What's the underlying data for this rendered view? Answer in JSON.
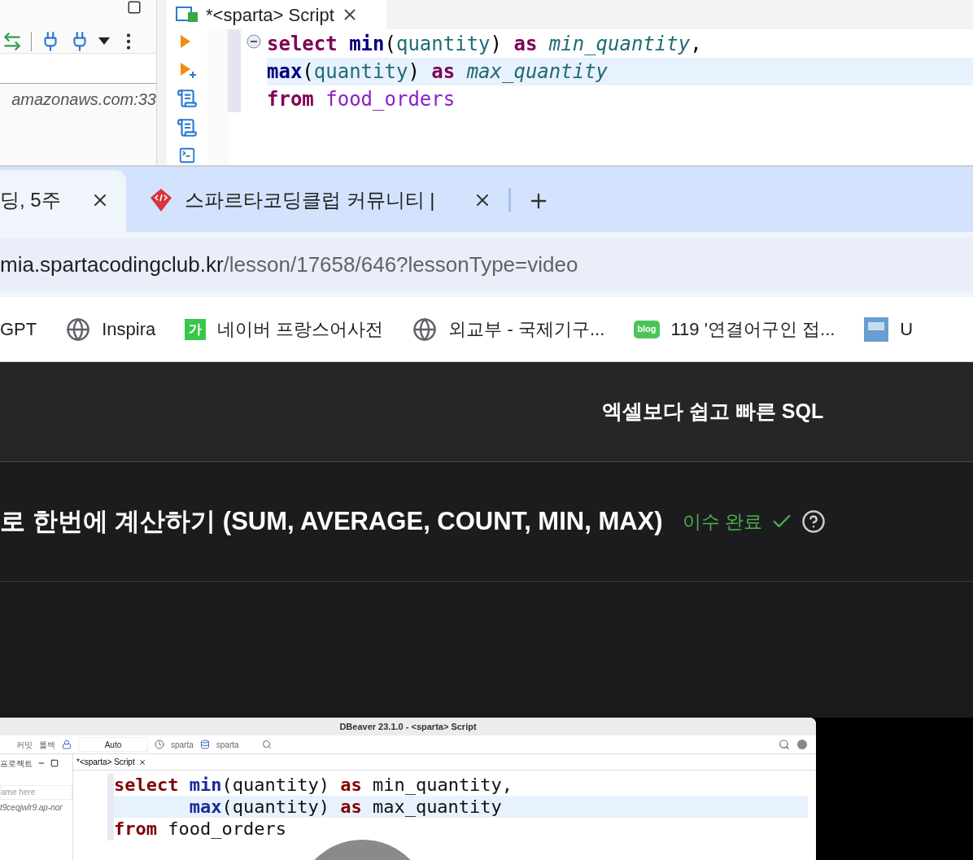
{
  "dbeaver": {
    "connection_text": "amazonaws.com:33",
    "editor_tab": {
      "title": "*<sparta> Script",
      "selected": true
    },
    "code_lines": [
      {
        "highlighted": false,
        "tokens": [
          {
            "kind": "keyword",
            "text": "select"
          },
          {
            "kind": "function",
            "text": " min"
          },
          {
            "kind": "punct",
            "text": "("
          },
          {
            "kind": "column",
            "text": "quantity"
          },
          {
            "kind": "punct",
            "text": ")"
          },
          {
            "kind": "keyword",
            "text": " as"
          },
          {
            "kind": "alias",
            "text": " min_quantity"
          },
          {
            "kind": "punct",
            "text": ","
          }
        ]
      },
      {
        "highlighted": true,
        "tokens": [
          {
            "kind": "function",
            "text": "max"
          },
          {
            "kind": "punct",
            "text": "("
          },
          {
            "kind": "column",
            "text": "quantity"
          },
          {
            "kind": "punct",
            "text": ")"
          },
          {
            "kind": "keyword",
            "text": " as"
          },
          {
            "kind": "alias",
            "text": " max_quantity"
          }
        ]
      },
      {
        "highlighted": false,
        "tokens": [
          {
            "kind": "keyword",
            "text": "from"
          },
          {
            "kind": "table",
            "text": " food_orders"
          }
        ]
      }
    ]
  },
  "browser": {
    "tabs": [
      {
        "title": "딩, 5주",
        "selected": true
      },
      {
        "title": "스파르타코딩클럽 커뮤니티 |",
        "selected": false
      }
    ],
    "address": {
      "host": "mia.spartacodingclub.kr",
      "path": "/lesson/17658/646?lessonType=video"
    },
    "bookmarks": [
      {
        "kind": "plain",
        "label": "GPT"
      },
      {
        "kind": "globe",
        "label": "Inspira"
      },
      {
        "kind": "naver",
        "badge": "가",
        "label": "네이버 프랑스어사전"
      },
      {
        "kind": "globe",
        "label": "외교부 - 국제기구..."
      },
      {
        "kind": "blog",
        "badge": "blog",
        "label": "119 '연결어구인 접..."
      },
      {
        "kind": "tile",
        "label": "U"
      }
    ]
  },
  "page": {
    "course_title": "엑셀보다 쉽고 빠른 SQL",
    "lesson_title": "로 한번에 계산하기 (SUM, AVERAGE, COUNT, MIN, MAX)",
    "status": "이수 완료",
    "completed": true
  },
  "video": {
    "window_title": "DBeaver 23.1.0 - <sparta> Script",
    "toolbar": [
      "커밋",
      "롤백",
      "Auto",
      "sparta",
      "sparta"
    ],
    "project_tab": "프로젝트",
    "filter_placeholder": "ame here",
    "connection_text": "t9ceqjwlr9.ap-nor",
    "editor_tab": {
      "title": "*<sparta> Script",
      "selected": true
    },
    "code_lines": [
      {
        "highlighted": false,
        "tokens": [
          {
            "kind": "keyword",
            "text": "select"
          },
          {
            "kind": "function",
            "text": " min"
          },
          {
            "kind": "punct",
            "text": "(quantity)"
          },
          {
            "kind": "keyword",
            "text": " as"
          },
          {
            "kind": "punct",
            "text": " min_quantity,"
          }
        ]
      },
      {
        "highlighted": true,
        "tokens": [
          {
            "kind": "function",
            "text": "       max"
          },
          {
            "kind": "punct",
            "text": "(quantity)"
          },
          {
            "kind": "keyword",
            "text": " as"
          },
          {
            "kind": "punct",
            "text": " max_quantity"
          }
        ]
      },
      {
        "highlighted": false,
        "tokens": [
          {
            "kind": "keyword",
            "text": "from"
          },
          {
            "kind": "punct",
            "text": " food_orders"
          }
        ]
      }
    ]
  }
}
